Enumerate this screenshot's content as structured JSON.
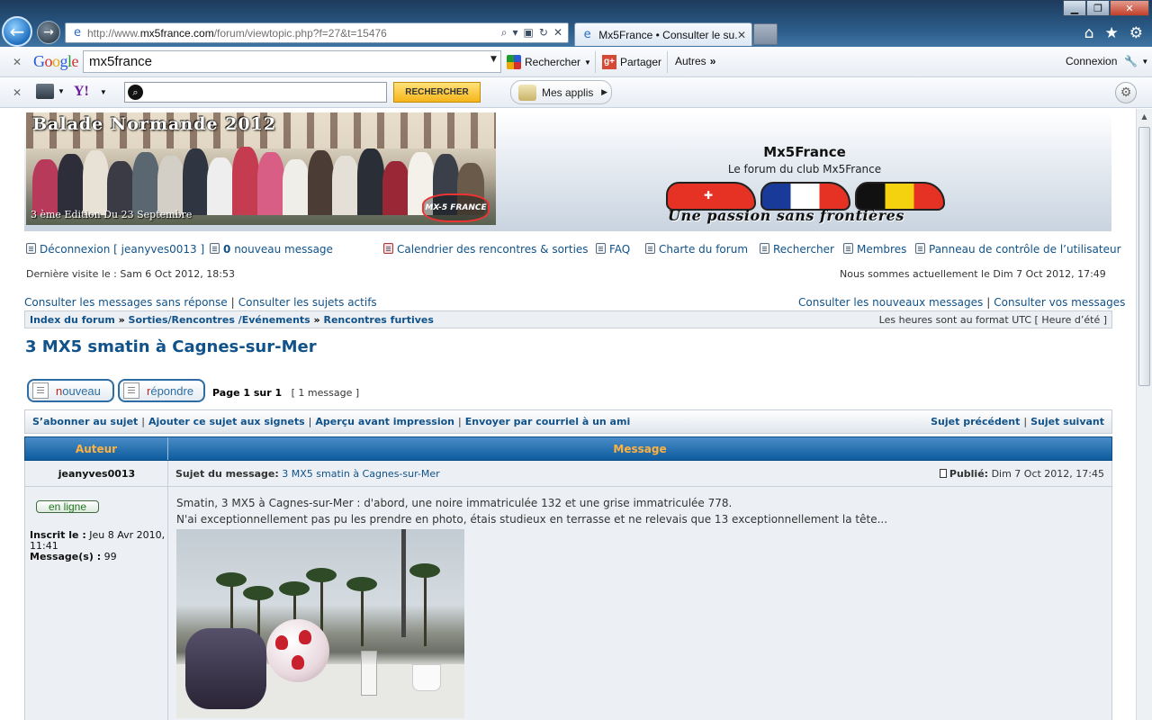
{
  "browser": {
    "url_prefix": "http://www.",
    "url_domain": "mx5france.com",
    "url_path": "/forum/viewtopic.php?f=27&t=15476",
    "tab_title": "Mx5France • Consulter le su...",
    "google_query": "mx5france",
    "google_search_label": "Rechercher",
    "share_label": "Partager",
    "autres_label": "Autres",
    "connexion_label": "Connexion",
    "yahoo_search_label": "RECHERCHER",
    "mes_applis_label": "Mes applis"
  },
  "banner": {
    "title": "Balade Normande 2012",
    "subtitle": "3 ème Edition Du 23 Septembre",
    "logo_text": "MX-5 FRANCE"
  },
  "site": {
    "title": "Mx5France",
    "description": "Le forum du club Mx5France",
    "slogan": "Une passion sans frontières"
  },
  "user_nav": {
    "logout": "Déconnexion [ jeanyves0013 ]",
    "new_messages_count": "0",
    "new_messages_label": "nouveau message",
    "calendar": "Calendrier des rencontres & sorties",
    "faq": "FAQ",
    "charter": "Charte du forum",
    "search": "Rechercher",
    "members": "Membres",
    "ucp": "Panneau de contrôle de l’utilisateur"
  },
  "visit": {
    "last_visit": "Dernière visite le : Sam 6 Oct 2012, 18:53",
    "current_time": "Nous sommes actuellement le Dim 7 Oct 2012, 17:49"
  },
  "quick_links": {
    "unanswered": "Consulter les messages sans réponse",
    "active": "Consulter les sujets actifs",
    "new_posts": "Consulter les nouveaux messages",
    "your_posts": "Consulter vos messages"
  },
  "breadcrumb": {
    "index": "Index du forum",
    "category": "Sorties/Rencontres /Evénements",
    "forum": "Rencontres furtives",
    "timezone": "Les heures sont au format UTC [ Heure d’été ]"
  },
  "topic": {
    "title": "3 MX5 smatin à Cagnes-sur-Mer",
    "new_btn_first": "n",
    "new_btn_rest": "ouveau",
    "reply_btn_first": "r",
    "reply_btn_rest": "épondre",
    "pagination": "Page 1 sur 1",
    "message_count": "[ 1 message ]"
  },
  "topic_tools": {
    "subscribe": "S’abonner au sujet",
    "bookmark": "Ajouter ce sujet aux signets",
    "print": "Aperçu avant impression",
    "email": "Envoyer par courriel à un ami",
    "prev": "Sujet précédent",
    "next": "Sujet suivant"
  },
  "table": {
    "author_header": "Auteur",
    "message_header": "Message"
  },
  "post": {
    "author": "jeanyves0013",
    "subject_label": "Sujet du message:",
    "subject": "3 MX5 smatin à Cagnes-sur-Mer",
    "posted_label": "Publié:",
    "posted_date": "Dim 7 Oct 2012, 17:45",
    "status": "en ligne",
    "joined_label": "Inscrit le :",
    "joined_date": "Jeu 8 Avr 2010, 11:41",
    "posts_label": "Message(s) :",
    "posts_count": "99",
    "line1": "Smatin, 3 MX5 à Cagnes-sur-Mer : d'abord, une noire immatriculée 132 et une grise immatriculée 778.",
    "line2": "N'ai exceptionnellement pas pu les prendre en photo, étais studieux en terrasse et ne relevais que 13 exceptionnellement la tête..."
  },
  "colors": {
    "link": "#105289",
    "table_header": "#0d5c9e",
    "table_header_text": "#ffb23f",
    "post_bg": "#ecf0f4"
  }
}
